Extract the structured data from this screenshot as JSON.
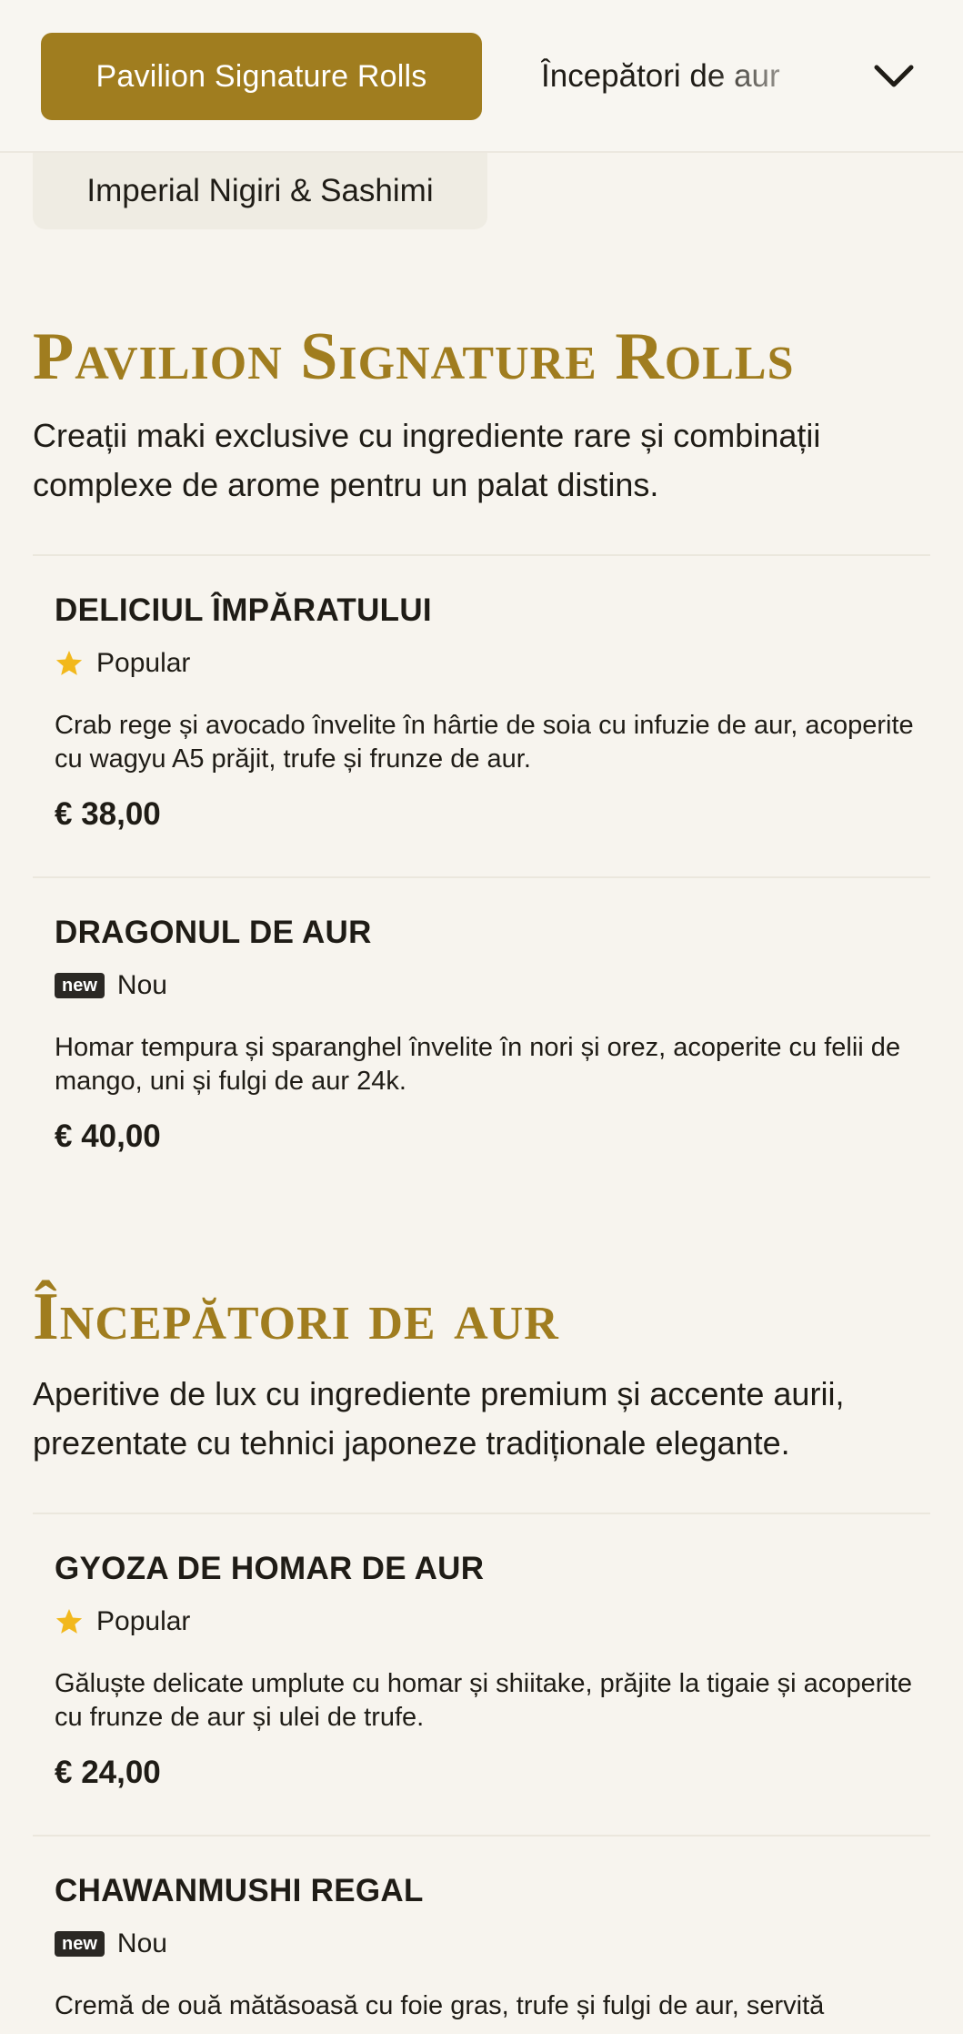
{
  "nav": {
    "active_category": "Pavilion Signature Rolls",
    "next_category": "Începători de aur",
    "second_row_category": "Imperial Nigiri & Sashimi",
    "expand_icon": "chevron-down-icon"
  },
  "colors": {
    "accent": "#a07d1f",
    "background": "#f7f4ee",
    "text": "#1f1c16",
    "star": "#f2b81c"
  },
  "sections": [
    {
      "title": "Pavilion Signature Rolls",
      "description": "Creații maki exclusive cu ingrediente rare și combinații complexe de arome pentru un palat distins.",
      "items": [
        {
          "name": "DELICIUL ÎMPĂRATULUI",
          "badge_type": "popular",
          "badge_icon": "star-icon",
          "badge_label": "Popular",
          "description": "Crab rege și avocado învelite în hârtie de soia cu infuzie de aur, acoperite cu wagyu A5 prăjit, trufe și frunze de aur.",
          "price": "€ 38,00"
        },
        {
          "name": "DRAGONUL DE AUR",
          "badge_type": "new",
          "badge_tag": "new",
          "badge_label": "Nou",
          "description": "Homar tempura și sparanghel învelite în nori și orez, acoperite cu felii de mango, uni și fulgi de aur 24k.",
          "price": "€ 40,00"
        }
      ]
    },
    {
      "title": "Începători de aur",
      "description": "Aperitive de lux cu ingrediente premium și accente aurii, prezentate cu tehnici japoneze tradiționale elegante.",
      "items": [
        {
          "name": "GYOZA DE HOMAR DE AUR",
          "badge_type": "popular",
          "badge_icon": "star-icon",
          "badge_label": "Popular",
          "description": "Găluște delicate umplute cu homar și shiitake, prăjite la tigaie și acoperite cu frunze de aur și ulei de trufe.",
          "price": "€ 24,00"
        },
        {
          "name": "CHAWANMUSHI REGAL",
          "badge_type": "new",
          "badge_tag": "new",
          "badge_label": "Nou",
          "description": "Cremă de ouă mătăsoasă cu foie gras, trufe și fulgi de aur, servită",
          "price": ""
        }
      ]
    }
  ]
}
